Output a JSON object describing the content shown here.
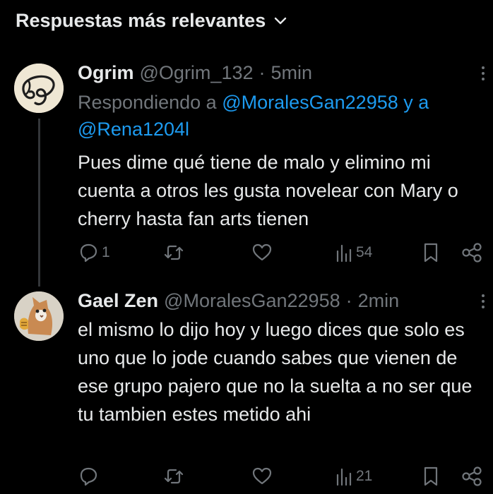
{
  "header": {
    "title": "Respuestas más relevantes"
  },
  "tweets": [
    {
      "name": "Ogrim",
      "handle": "@Ogrim_132",
      "sep": "·",
      "time": "5min",
      "replying_prefix": "Respondiendo a",
      "mention1": "@MoralesGan22958",
      "replying_joiner": "y a",
      "mention2": "@Rena1204l",
      "text": "Pues dime qué tiene de malo y elimino mi cuenta a otros les gusta novelear con Mary o cherry hasta fan arts tienen",
      "reply_count": "1",
      "views": "54"
    },
    {
      "name": "Gael Zen",
      "handle": "@MoralesGan22958",
      "sep": "·",
      "time": "2min",
      "text": "el mismo lo dijo hoy y luego dices que solo es uno que lo jode cuando sabes que vienen de ese grupo pajero que no la suelta a no ser que tu tambien estes metido ahi",
      "reply_count": "",
      "views": "21"
    }
  ],
  "icons": {
    "reply": "reply-icon",
    "retweet": "retweet-icon",
    "like": "heart-icon",
    "views": "views-icon",
    "bookmark": "bookmark-icon",
    "share": "share-icon",
    "more": "more-icon",
    "chevron": "chevron-down-icon"
  },
  "colors": {
    "background": "#000000",
    "text": "#e7e9ea",
    "muted": "#71767b",
    "accent": "#1d9bf0"
  }
}
